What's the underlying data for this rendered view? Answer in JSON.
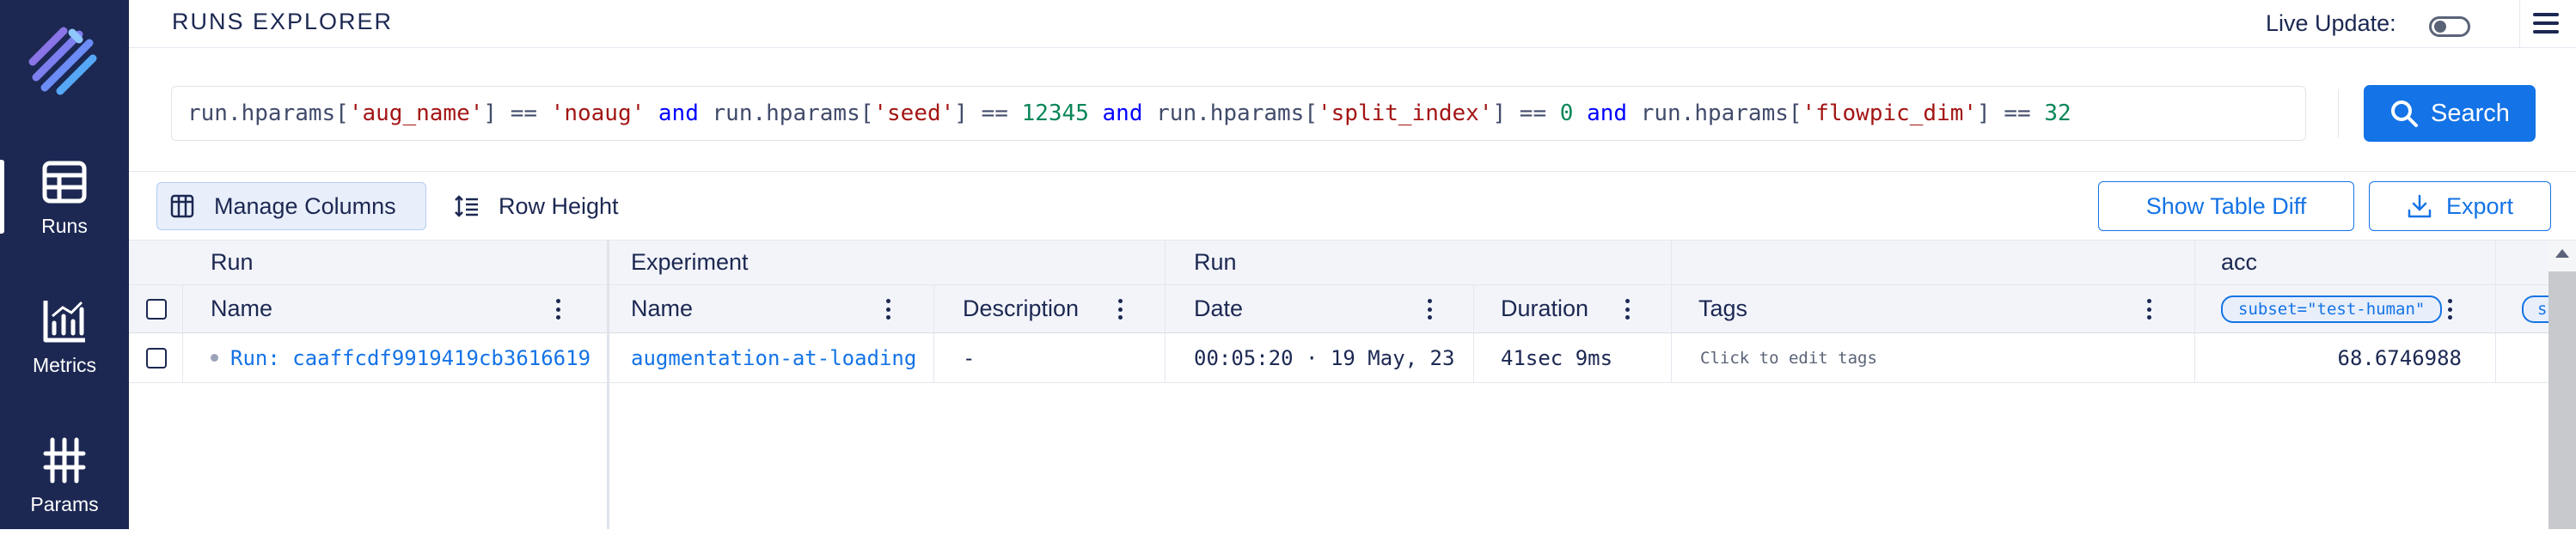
{
  "sidebar": {
    "logo": "aim-logo",
    "items": [
      {
        "label": "Runs",
        "icon": "table-icon",
        "active": true
      },
      {
        "label": "Metrics",
        "icon": "chart-icon",
        "active": false
      },
      {
        "label": "Params",
        "icon": "params-icon",
        "active": false
      }
    ]
  },
  "header": {
    "title": "RUNS EXPLORER",
    "live_update_label": "Live Update:",
    "live_update_on": false
  },
  "search": {
    "query_tokens": [
      {
        "t": "run.hparams[",
        "k": "plain"
      },
      {
        "t": "'aug_name'",
        "k": "str"
      },
      {
        "t": "] == ",
        "k": "plain"
      },
      {
        "t": "'noaug'",
        "k": "str"
      },
      {
        "t": " and ",
        "k": "kw"
      },
      {
        "t": "run.hparams[",
        "k": "plain"
      },
      {
        "t": "'seed'",
        "k": "str"
      },
      {
        "t": "] == ",
        "k": "plain"
      },
      {
        "t": "12345",
        "k": "num"
      },
      {
        "t": " and ",
        "k": "kw"
      },
      {
        "t": "run.hparams[",
        "k": "plain"
      },
      {
        "t": "'split_index'",
        "k": "str"
      },
      {
        "t": "] == ",
        "k": "plain"
      },
      {
        "t": "0",
        "k": "num"
      },
      {
        "t": " and ",
        "k": "kw"
      },
      {
        "t": "run.hparams[",
        "k": "plain"
      },
      {
        "t": "'flowpic_dim'",
        "k": "str"
      },
      {
        "t": "] == ",
        "k": "plain"
      },
      {
        "t": "32",
        "k": "num"
      }
    ],
    "button_label": "Search"
  },
  "toolbar": {
    "manage_columns_label": "Manage Columns",
    "row_height_label": "Row Height",
    "show_table_diff_label": "Show Table Diff",
    "export_label": "Export"
  },
  "table": {
    "groups": {
      "run": "Run",
      "experiment": "Experiment",
      "run2": "Run",
      "acc": "acc"
    },
    "columns": {
      "name": "Name",
      "exp_name": "Name",
      "description": "Description",
      "date": "Date",
      "duration": "Duration",
      "tags": "Tags",
      "acc_subset": "subset=\"test-human\"",
      "next_subset": "s"
    },
    "rows": [
      {
        "run_name": "Run: caaffcdf9919419cb3616619",
        "experiment": "augmentation-at-loading",
        "description": "-",
        "date": "00:05:20 · 19 May, 23",
        "duration": "41sec 9ms",
        "tags": "Click to edit tags",
        "acc": "68.6746988"
      }
    ]
  },
  "colors": {
    "sidebar_bg": "#1c2852",
    "accent": "#1473e6",
    "query_string": "#a31515",
    "query_keyword": "#0000ff",
    "query_number": "#098658"
  }
}
